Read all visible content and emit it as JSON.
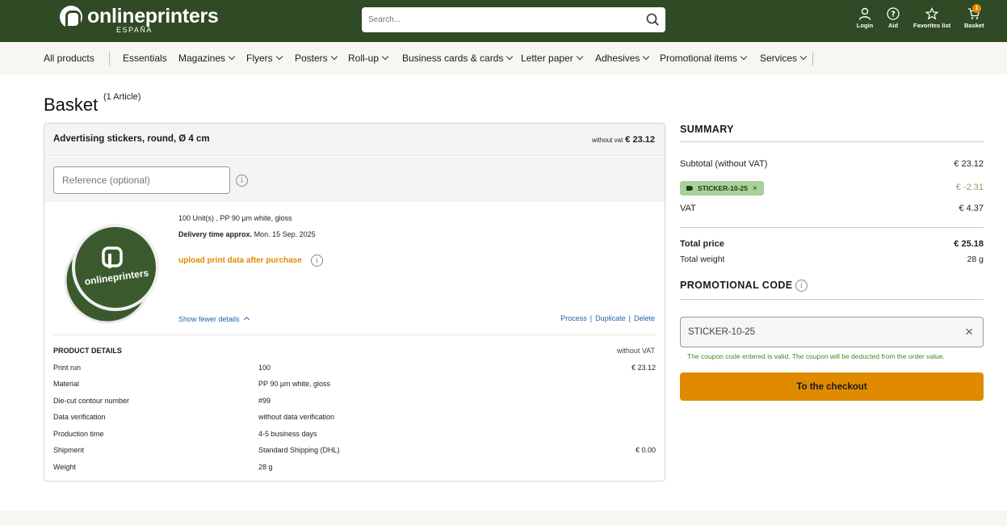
{
  "header": {
    "logo_text": "onlineprinters",
    "logo_sub": "ESPAÑA",
    "search_placeholder": "Search...",
    "login_label": "Login",
    "aid_label": "Aid",
    "favorites_label": "Favorites list",
    "basket_label": "Basket",
    "basket_count": "1"
  },
  "nav": {
    "items": [
      "All products",
      "Essentials",
      "Magazines",
      "Flyers",
      "Posters",
      "Roll-up",
      "Business cards & cards",
      "Letter paper",
      "Adhesives",
      "Promotional items",
      "Services"
    ]
  },
  "page": {
    "title": "Basket",
    "article_count": "(1 Article)"
  },
  "item": {
    "title": "Advertising stickers, round, Ø 4 cm",
    "price_note": "without vat",
    "price": "€ 23.12",
    "reference_placeholder": "Reference (optional)",
    "spec_line": "100 Unit(s) , PP 90 µm white, gloss",
    "delivery_label": "Delivery time approx.",
    "delivery_date": "Mon. 15 Sep. 2025",
    "upload_label": "upload print data after purchase",
    "fewer_details": "Show fewer details",
    "actions": {
      "process": "Process",
      "duplicate": "Duplicate",
      "delete": "Delete"
    },
    "sticker_text": "onlineprinters"
  },
  "product_details": {
    "heading": "PRODUCT DETAILS",
    "vat_note": "without VAT",
    "rows": [
      {
        "key": "Print run",
        "value": "100",
        "price": "€ 23.12"
      },
      {
        "key": "Material",
        "value": "PP 90 µm white, gloss",
        "price": ""
      },
      {
        "key": "Die-cut contour number",
        "value": "#99",
        "price": ""
      },
      {
        "key": "Data verification",
        "value": "without data verification",
        "price": ""
      },
      {
        "key": "Production time",
        "value": "4-5 business days",
        "price": ""
      },
      {
        "key": "Shipment",
        "value": "Standard Shipping (DHL)",
        "price": "€ 0.00"
      },
      {
        "key": "Weight",
        "value": "28 g",
        "price": ""
      }
    ]
  },
  "summary": {
    "title": "SUMMARY",
    "subtotal_label": "Subtotal (without VAT)",
    "subtotal_value": "€ 23.12",
    "coupon_tag": "STICKER-10-25",
    "discount_value": "€ -2.31",
    "vat_label": "VAT",
    "vat_value": "€ 4.37",
    "total_label": "Total price",
    "total_value": "€ 25.18",
    "weight_label": "Total weight",
    "weight_value": "28 g"
  },
  "promo": {
    "title": "PROMOTIONAL CODE",
    "code_value": "STICKER-10-25",
    "message": "The coupon code entered is valid. The coupon will be deducted from the order value.",
    "checkout_label": "To the checkout"
  },
  "colors": {
    "header_bg": "#2f4a24",
    "accent": "#e08a00",
    "link": "#2463a8",
    "success": "#3c8c1e",
    "coupon_bg": "#a8d29a"
  }
}
